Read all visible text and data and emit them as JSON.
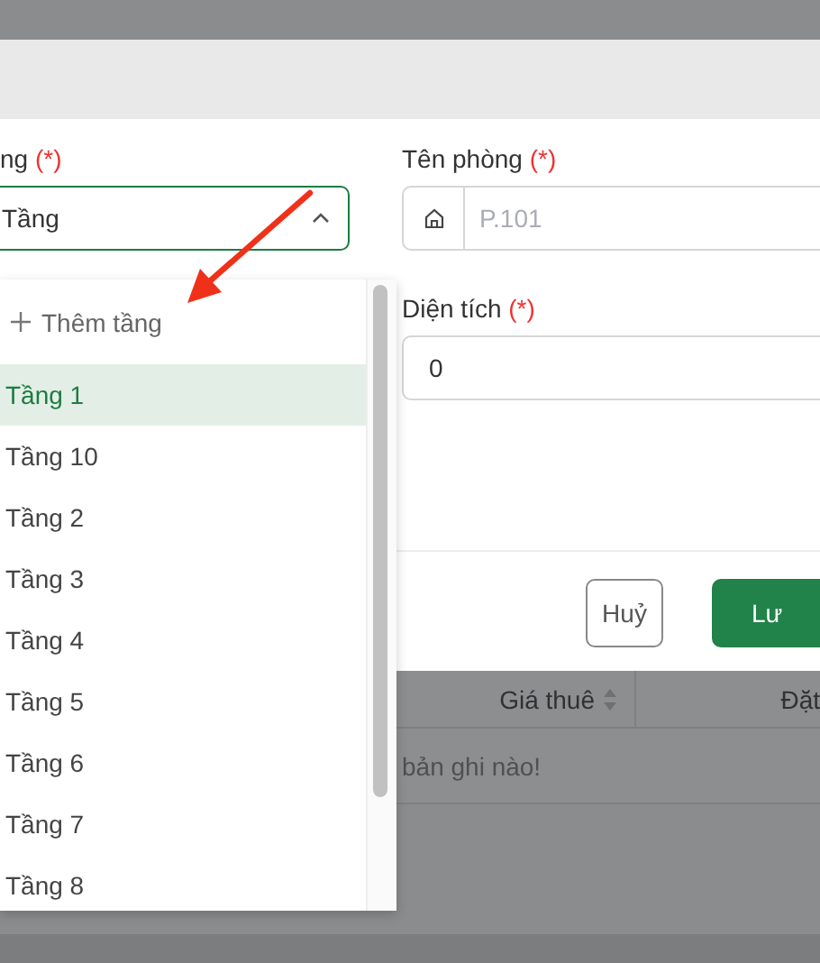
{
  "form": {
    "floor_field": {
      "label": "ng",
      "required_mark": "(*)",
      "value": "Tầng",
      "expanded": true
    },
    "room_name_field": {
      "label": "Tên phòng",
      "required_mark": "(*)",
      "placeholder": "P.101"
    },
    "area_field": {
      "label": "Diện tích",
      "required_mark": "(*)",
      "value": "0"
    }
  },
  "buttons": [
    {
      "label": "Huỷ",
      "kind": "secondary"
    },
    {
      "label": "Lư",
      "kind": "primary"
    }
  ],
  "dropdown": {
    "add_option": "Thêm tầng",
    "items": [
      {
        "label": "Tầng 1",
        "selected": true
      },
      {
        "label": "Tầng 10",
        "selected": false
      },
      {
        "label": "Tầng 2",
        "selected": false
      },
      {
        "label": "Tầng 3",
        "selected": false
      },
      {
        "label": "Tầng 4",
        "selected": false
      },
      {
        "label": "Tầng 5",
        "selected": false
      },
      {
        "label": "Tầng 6",
        "selected": false
      },
      {
        "label": "Tầng 7",
        "selected": false
      },
      {
        "label": "Tầng 8",
        "selected": false
      }
    ]
  },
  "background_table": {
    "columns": [
      {
        "label": "Giá thuê",
        "sortable": true
      },
      {
        "label": "Đặt",
        "sortable": false
      }
    ],
    "empty_message": "bản ghi nào!"
  }
}
